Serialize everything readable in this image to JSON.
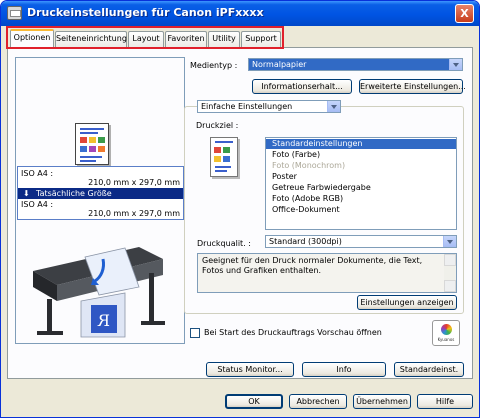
{
  "window": {
    "title": "Druckeinstellungen für Canon iPFxxxx",
    "close_label": "X"
  },
  "tabs": [
    {
      "label": "Optionen",
      "active": true
    },
    {
      "label": "Seiteneinrichtung",
      "active": false
    },
    {
      "label": "Layout",
      "active": false
    },
    {
      "label": "Favoriten",
      "active": false
    },
    {
      "label": "Utility",
      "active": false
    },
    {
      "label": "Support",
      "active": false
    }
  ],
  "preview": {
    "size_label_top": "ISO A4 :",
    "size_value_top": "210,0 mm x 297,0 mm",
    "actual_size_label": "Tatsächliche Größe",
    "size_label_bottom": "ISO A4 :",
    "size_value_bottom": "210,0 mm x 297,0 mm",
    "printer_paper_letter": "R"
  },
  "media": {
    "label": "Medientyp :",
    "value": "Normalpapier",
    "info_button": "Informationserhalt...",
    "advanced_button": "Erweiterte Einstellungen..."
  },
  "mode_select": {
    "value": "Einfache Einstellungen"
  },
  "druckziel": {
    "label": "Druckziel :",
    "items": [
      {
        "label": "Standardeinstellungen",
        "state": "selected"
      },
      {
        "label": "Foto (Farbe)",
        "state": "normal"
      },
      {
        "label": "Foto (Monochrom)",
        "state": "disabled"
      },
      {
        "label": "Poster",
        "state": "normal"
      },
      {
        "label": "Getreue Farbwiedergabe",
        "state": "normal"
      },
      {
        "label": "Foto (Adobe RGB)",
        "state": "normal"
      },
      {
        "label": "Office-Dokument",
        "state": "normal"
      }
    ]
  },
  "quality": {
    "label": "Druckqualit. :",
    "value": "Standard (300dpi)"
  },
  "description": "Geeignet für den Druck normaler Dokumente, die Text, Fotos und Grafiken enthalten.",
  "show_settings_button": "Einstellungen anzeigen",
  "preview_checkbox_label": "Bei Start des Druckauftrags Vorschau öffnen",
  "kyuanos_label": "Kyuanos",
  "bottom_buttons": {
    "status_monitor": "Status Monitor...",
    "info": "Info",
    "defaults": "Standardeinst."
  },
  "dialog_buttons": {
    "ok": "OK",
    "cancel": "Abbrechen",
    "apply": "Übernehmen",
    "help": "Hilfe"
  }
}
